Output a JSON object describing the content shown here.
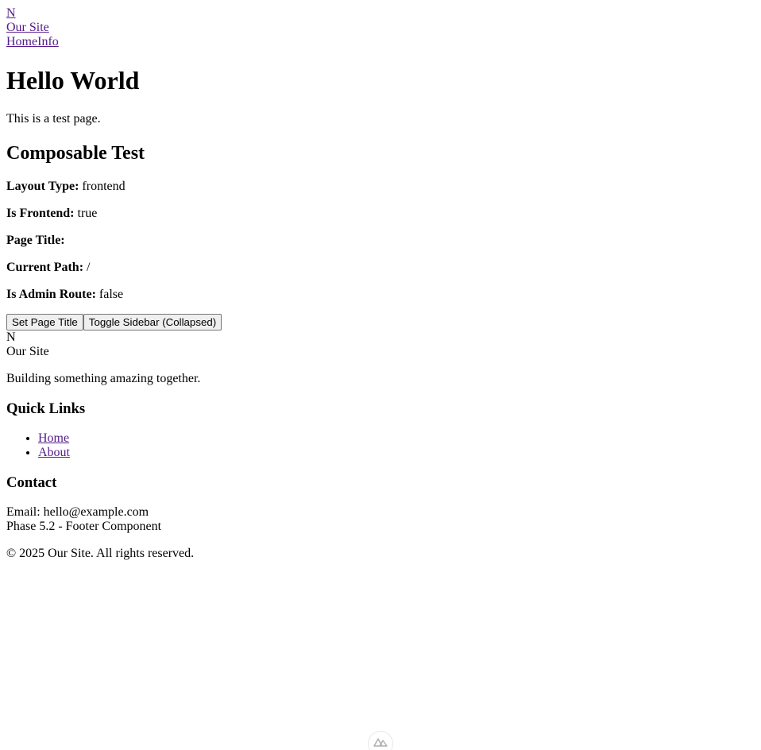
{
  "header": {
    "logo_letter": "N",
    "site_name": "Our Site",
    "nav": [
      {
        "label": "Home"
      },
      {
        "label": "Info"
      }
    ]
  },
  "main": {
    "heading": "Hello World",
    "intro": "This is a test page.",
    "composable_heading": "Composable Test",
    "fields": [
      {
        "label": "Layout Type:",
        "value": "frontend"
      },
      {
        "label": "Is Frontend:",
        "value": "true"
      },
      {
        "label": "Page Title:",
        "value": ""
      },
      {
        "label": "Current Path:",
        "value": "/"
      },
      {
        "label": "Is Admin Route:",
        "value": "false"
      }
    ],
    "buttons": {
      "set_title": "Set Page Title",
      "toggle_sidebar": "Toggle Sidebar (Collapsed)"
    }
  },
  "footer": {
    "logo_letter": "N",
    "site_name": "Our Site",
    "tagline": "Building something amazing together.",
    "quick_links_heading": "Quick Links",
    "quick_links": [
      {
        "label": "Home"
      },
      {
        "label": "About"
      }
    ],
    "contact_heading": "Contact",
    "email": "Email: hello@example.com",
    "phase": "Phase 5.2 - Footer Component",
    "copyright": "© 2025 Our Site. All rights reserved."
  }
}
